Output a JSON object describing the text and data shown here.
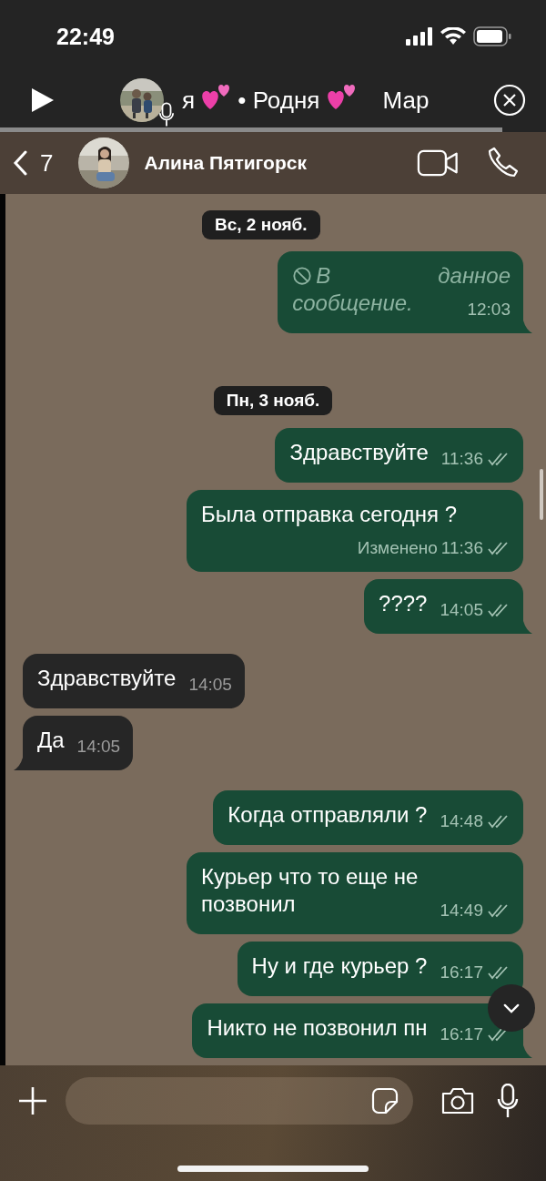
{
  "status_bar": {
    "time": "22:49"
  },
  "now_playing": {
    "segments": [
      {
        "kind": "text",
        "text": "я"
      },
      {
        "kind": "hearts"
      },
      {
        "kind": "text",
        "text": "• Родня"
      },
      {
        "kind": "hearts"
      }
    ],
    "next_title": "Мар",
    "level": 0.92
  },
  "chat_header": {
    "back_count": "7",
    "name": "Алина Пятигорск"
  },
  "sticky_date": "Вс, 2 нояб.",
  "messages": [
    {
      "kind": "deleted",
      "parts": [
        "В",
        "данное",
        "сообщение."
      ],
      "time": "12:03",
      "tail": true
    },
    {
      "kind": "date",
      "text": "Пн, 3 нояб."
    },
    {
      "kind": "out",
      "text": "Здравствуйте",
      "time": "11:36",
      "read": false,
      "tail": false
    },
    {
      "kind": "out",
      "text": "Была отправка сегодня ?",
      "edited": "Изменено",
      "time": "11:36",
      "read": false,
      "tail": false
    },
    {
      "kind": "out",
      "text": "????",
      "time": "14:05",
      "read": false,
      "tail": true
    },
    {
      "kind": "in",
      "text": "Здравствуйте",
      "time": "14:05",
      "tail": false
    },
    {
      "kind": "in",
      "text": "Да",
      "time": "14:05",
      "tail": true
    },
    {
      "kind": "out",
      "text": "Когда отправляли ?",
      "time": "14:48",
      "read": false,
      "tail": false
    },
    {
      "kind": "out",
      "text": "Курьер что то еще не позвонил",
      "time": "14:49",
      "read": false,
      "tail": false
    },
    {
      "kind": "out",
      "text": "Ну и где курьер ?",
      "time": "16:17",
      "read": false,
      "tail": false
    },
    {
      "kind": "out",
      "text": "Никто не позвонил пн",
      "time": "16:17",
      "read": false,
      "tail": true
    }
  ]
}
